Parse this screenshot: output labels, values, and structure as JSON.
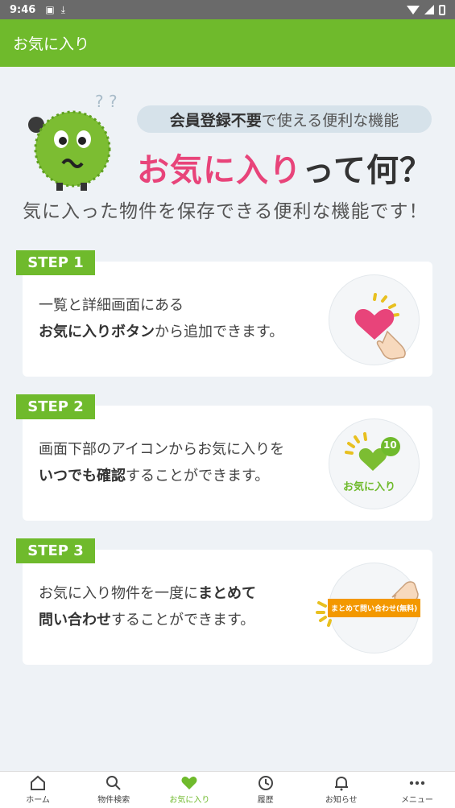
{
  "statusbar": {
    "time": "9:46",
    "icons": [
      "a-box-icon",
      "download-icon",
      "wifi-icon",
      "signal-icon",
      "battery-icon"
    ]
  },
  "appbar": {
    "title": "お気に入り"
  },
  "hero": {
    "pill_bold": "会員登録不要",
    "pill_rest": "で使える便利な機能",
    "headline_pink": "お気に入り",
    "headline_rest": "って何？",
    "subtitle": "気に入った物件を保存できる便利な機能です！",
    "mascot_marks": "? ?"
  },
  "steps": [
    {
      "tag": "STEP 1",
      "line1": "一覧と詳細画面にある",
      "line2_bold": "お気に入りボタン",
      "line2_rest": "から追加できます。"
    },
    {
      "tag": "STEP 2",
      "line1": "画面下部のアイコンからお気に入りを",
      "line2_bold": "いつでも確認",
      "line2_rest": "することができます。",
      "badge_count": "10",
      "badge_label": "お気に入り"
    },
    {
      "tag": "STEP 3",
      "line1_rest": "お気に入り物件を一度に",
      "line1_bold": "まとめて",
      "line2_bold": "問い合わせ",
      "line2_rest": "することができます。",
      "button_label": "まとめて問い合わせ(無料)"
    }
  ],
  "bottom_nav": [
    {
      "label": "ホーム",
      "icon": "home-icon",
      "active": false
    },
    {
      "label": "物件検索",
      "icon": "search-icon",
      "active": false
    },
    {
      "label": "お気に入り",
      "icon": "heart-icon",
      "active": true
    },
    {
      "label": "履歴",
      "icon": "history-icon",
      "active": false
    },
    {
      "label": "お知らせ",
      "icon": "bell-icon",
      "active": false
    },
    {
      "label": "メニュー",
      "icon": "more-icon",
      "active": false
    }
  ],
  "colors": {
    "brand_green": "#6fba2c",
    "accent_pink": "#e8447a",
    "button_orange": "#f39800"
  }
}
